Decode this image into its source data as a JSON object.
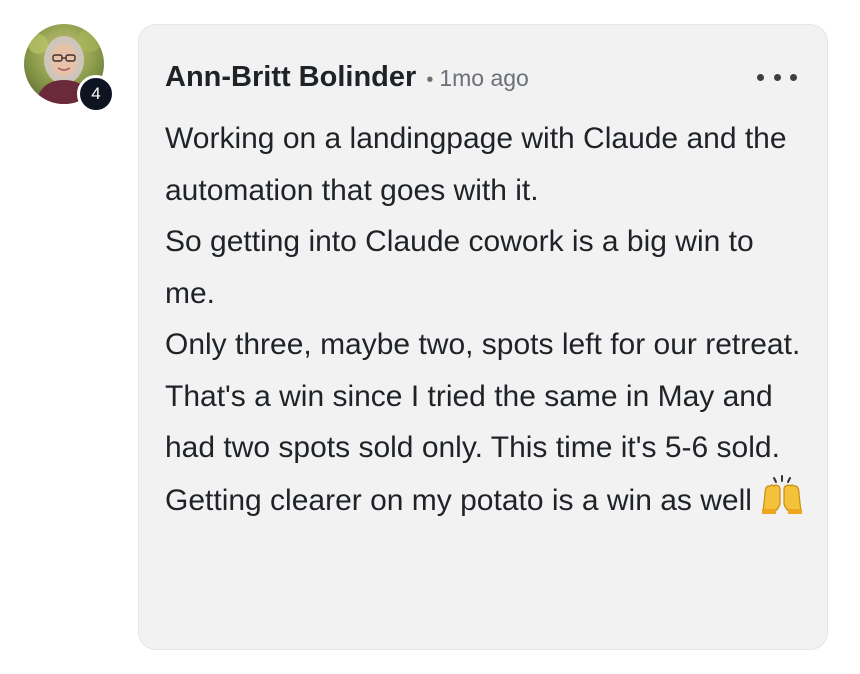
{
  "comment": {
    "avatar_icon": "user-avatar-photo",
    "level_badge": "4",
    "author": "Ann-Britt Bolinder",
    "separator": "•",
    "timestamp": "1mo ago",
    "more_icon": "more-horizontal-icon",
    "paragraphs": [
      "Working on a landingpage with Claude and the automation that goes with it.",
      "So getting into Claude cowork is a big win to me.",
      "Only three, maybe two, spots left for our retreat. That's a win since I tried the same in May and had two spots sold only. This time it's 5-6 sold.",
      "Getting clearer on my potato is a win as well"
    ],
    "trailing_emoji": "raising-hands-emoji"
  },
  "colors": {
    "bubble_bg": "#f2f2f2",
    "badge_bg": "#0d1321",
    "text": "#1f2328",
    "muted": "#6b6f76"
  }
}
